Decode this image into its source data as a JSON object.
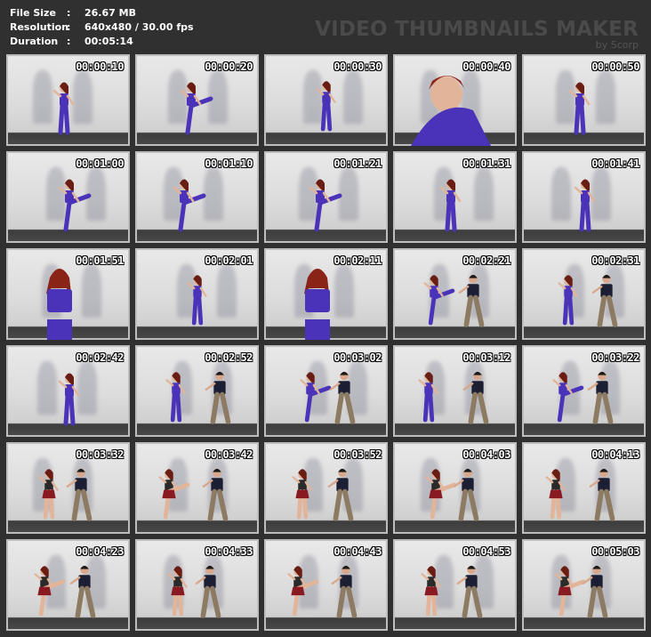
{
  "info": {
    "file_size_label": "File Size",
    "file_size_value": "26.67 MB",
    "resolution_label": "Resolution",
    "resolution_value": "640x480 / 30.00 fps",
    "duration_label": "Duration",
    "duration_value": "00:05:14",
    "separator": ":"
  },
  "brand": {
    "title": "VIDEO THUMBNAILS MAKER",
    "subtitle": "by Scorp"
  },
  "thumbnails": [
    {
      "time": "00:00:10",
      "scene": "woman-purple"
    },
    {
      "time": "00:00:20",
      "scene": "woman-purple-kick"
    },
    {
      "time": "00:00:30",
      "scene": "woman-purple-far"
    },
    {
      "time": "00:00:40",
      "scene": "closeup"
    },
    {
      "time": "00:00:50",
      "scene": "woman-purple"
    },
    {
      "time": "00:01:00",
      "scene": "woman-purple-kick"
    },
    {
      "time": "00:01:10",
      "scene": "woman-purple-kick"
    },
    {
      "time": "00:01:21",
      "scene": "woman-purple-kick"
    },
    {
      "time": "00:01:31",
      "scene": "woman-purple"
    },
    {
      "time": "00:01:41",
      "scene": "woman-purple"
    },
    {
      "time": "00:01:51",
      "scene": "closeup-standing"
    },
    {
      "time": "00:02:01",
      "scene": "woman-purple-far"
    },
    {
      "time": "00:02:11",
      "scene": "closeup-standing"
    },
    {
      "time": "00:02:21",
      "scene": "duo-purple"
    },
    {
      "time": "00:02:31",
      "scene": "duo-purple"
    },
    {
      "time": "00:02:42",
      "scene": "woman-purple"
    },
    {
      "time": "00:02:52",
      "scene": "duo-purple"
    },
    {
      "time": "00:03:02",
      "scene": "duo-purple"
    },
    {
      "time": "00:03:12",
      "scene": "duo-purple"
    },
    {
      "time": "00:03:22",
      "scene": "duo-purple"
    },
    {
      "time": "00:03:32",
      "scene": "duo-red"
    },
    {
      "time": "00:03:42",
      "scene": "duo-red"
    },
    {
      "time": "00:03:52",
      "scene": "duo-red"
    },
    {
      "time": "00:04:03",
      "scene": "duo-red"
    },
    {
      "time": "00:04:13",
      "scene": "duo-red"
    },
    {
      "time": "00:04:23",
      "scene": "duo-red"
    },
    {
      "time": "00:04:33",
      "scene": "duo-red"
    },
    {
      "time": "00:04:43",
      "scene": "duo-red"
    },
    {
      "time": "00:04:53",
      "scene": "duo-red"
    },
    {
      "time": "00:05:03",
      "scene": "duo-red"
    }
  ],
  "colors": {
    "background": "#303030",
    "outfit_purple": "#4a33b8",
    "outfit_red": "#8a1a22",
    "pants_khaki": "#8c7a62",
    "shirt_navy": "#1c1f33"
  }
}
